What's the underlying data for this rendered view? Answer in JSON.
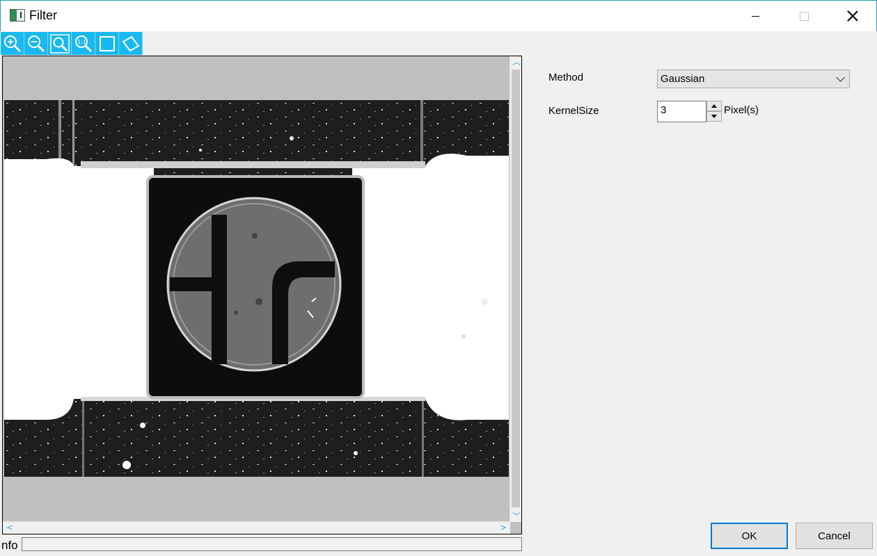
{
  "window": {
    "title": "Filter",
    "icon": "filter-app-icon"
  },
  "toolbar": {
    "tools": [
      "zoom-in-icon",
      "zoom-out-icon",
      "zoom-fit-icon",
      "zoom-1to1-icon",
      "rectangle-roi-icon",
      "rotated-rectangle-roi-icon"
    ],
    "accent": "#19b8f0",
    "one_to_one_text": "1:1"
  },
  "viewer": {
    "background": "#c0c0c0",
    "image": "inspection-photo-of-smd-component",
    "scroll_arrow_color": "#33a6d8"
  },
  "status": {
    "info_label": "nfo",
    "info_value": ""
  },
  "params": {
    "method_label": "Method",
    "method_value": "Gaussian",
    "kernel_label": "KernelSize",
    "kernel_value": "3",
    "kernel_unit": "Pixel(s)"
  },
  "buttons": {
    "ok": "OK",
    "cancel": "Cancel",
    "ok_focus_color": "#0078d7"
  }
}
